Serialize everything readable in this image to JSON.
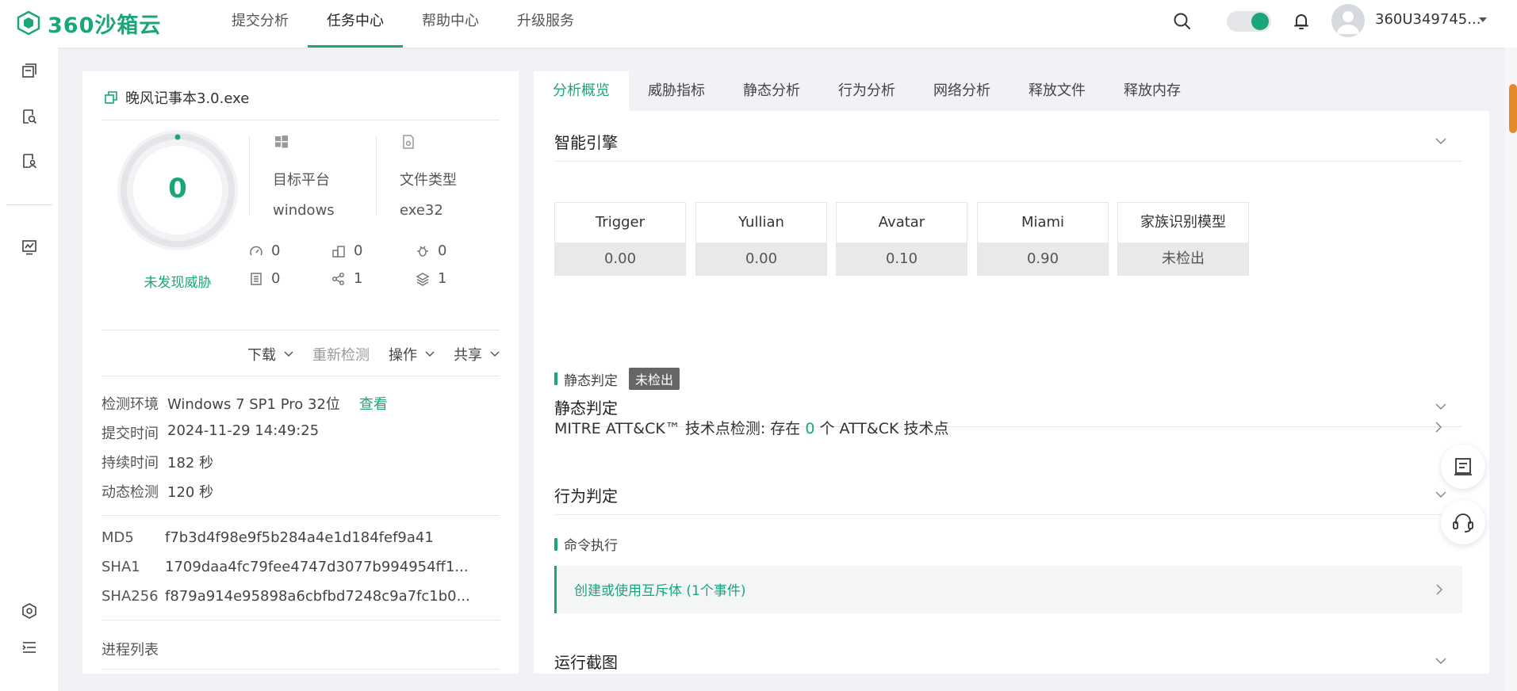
{
  "brand": {
    "name": "360沙箱云",
    "color": "#1aa57a"
  },
  "nav": [
    {
      "label": "提交分析",
      "active": false
    },
    {
      "label": "任务中心",
      "active": true
    },
    {
      "label": "帮助中心",
      "active": false
    },
    {
      "label": "升级服务",
      "active": false
    }
  ],
  "user": {
    "name": "360U349745..."
  },
  "sidebar": {
    "icons": [
      "task-list-icon",
      "report-search-icon",
      "report-user-icon",
      "monitor-chart-icon",
      "settings-icon",
      "menu-list-icon"
    ]
  },
  "file": {
    "name": "晚风记事本3.0.exe",
    "score": "0",
    "threat_label": "未发现威胁",
    "platform_label": "目标平台",
    "platform_value": "windows",
    "filetype_label": "文件类型",
    "filetype_value": "exe32",
    "stats": [
      "0",
      "0",
      "0",
      "0",
      "1",
      "1"
    ]
  },
  "actions": {
    "download": "下载",
    "recheck": "重新检测",
    "operate": "操作",
    "share": "共享"
  },
  "info": {
    "env_key": "检测环境",
    "env_val": "Windows 7 SP1 Pro 32位",
    "env_link": "查看",
    "submit_key": "提交时间",
    "submit_val": "2024-11-29 14:49:25",
    "duration_key": "持续时间",
    "duration_val": "182 秒",
    "dynamic_key": "动态检测",
    "dynamic_val": "120 秒"
  },
  "hashes": {
    "md5_key": "MD5",
    "md5_val": "f7b3d4f98e9f5b284a4e1d184fef9a41",
    "sha1_key": "SHA1",
    "sha1_val": "1709daa4fc79fee4747d3077b994954ff1...",
    "sha256_key": "SHA256",
    "sha256_val": "f879a914e95898a6cbfbd7248c9a7fc1b0..."
  },
  "process_title": "进程列表",
  "tabs": [
    {
      "label": "分析概览",
      "active": true
    },
    {
      "label": "威胁指标",
      "active": false
    },
    {
      "label": "静态分析",
      "active": false
    },
    {
      "label": "行为分析",
      "active": false
    },
    {
      "label": "网络分析",
      "active": false
    },
    {
      "label": "释放文件",
      "active": false
    },
    {
      "label": "释放内存",
      "active": false
    }
  ],
  "sections": {
    "engine_title": "智能引擎",
    "static_title": "静态判定",
    "behavior_title": "行为判定",
    "screenshot_title": "运行截图"
  },
  "engines": [
    {
      "name": "Trigger",
      "score": "0.00"
    },
    {
      "name": "Yullian",
      "score": "0.00"
    },
    {
      "name": "Avatar",
      "score": "0.10"
    },
    {
      "name": "Miami",
      "score": "0.90"
    },
    {
      "name": "家族识别模型",
      "score": "未检出"
    }
  ],
  "static_result": {
    "label": "静态判定",
    "badge": "未检出"
  },
  "mitre": {
    "prefix": "MITRE ATT&CK™ 技术点检测:  存在 ",
    "count": "0",
    "suffix": " 个 ATT&CK 技术点"
  },
  "behavior": {
    "category": "命令执行",
    "event": "创建或使用互斥体 (1个事件)"
  }
}
